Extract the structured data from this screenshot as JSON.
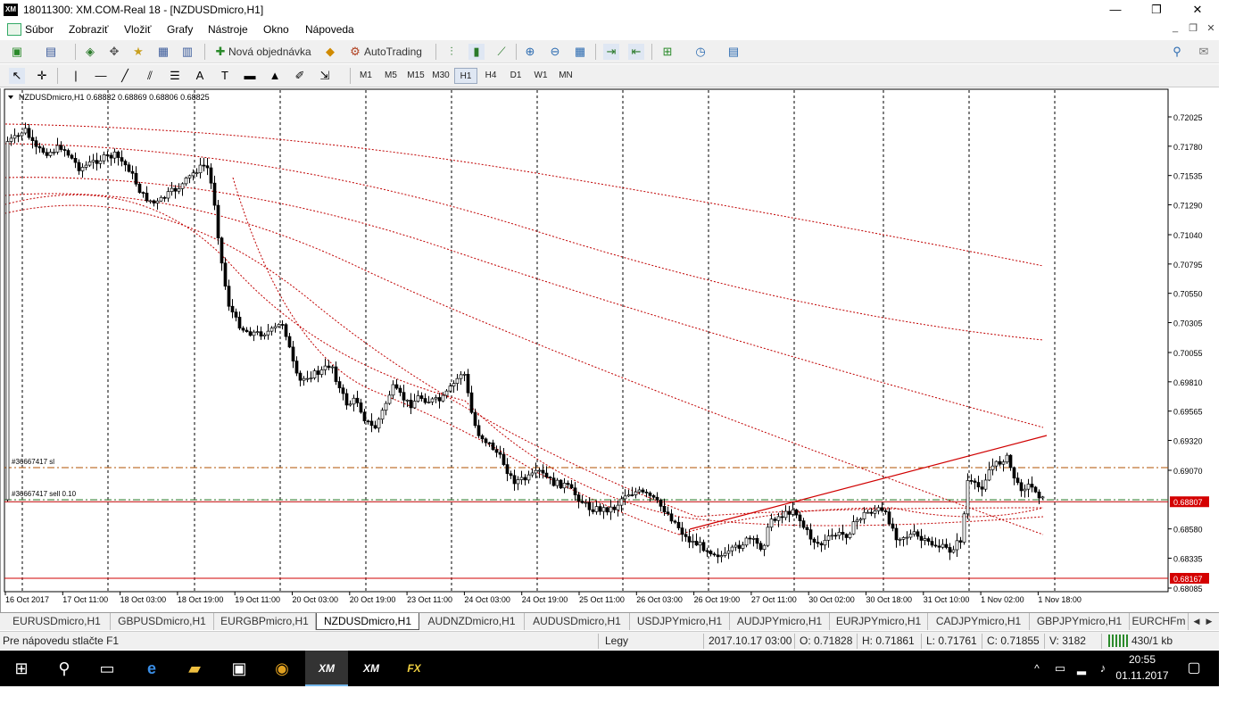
{
  "window": {
    "title": "18011300: XM.COM-Real 18 - [NZDUSDmicro,H1]",
    "logo": "XM",
    "minimize": "—",
    "maximize": "❐",
    "close": "✕"
  },
  "menu": {
    "items": [
      "Súbor",
      "Zobraziť",
      "Vložiť",
      "Grafy",
      "Nástroje",
      "Okno",
      "Nápoveda"
    ],
    "mdi_minimize": "_",
    "mdi_restore": "❐",
    "mdi_close": "✕"
  },
  "toolbar": {
    "new_order_label": "Nová objednávka",
    "autotrading_label": "AutoTrading",
    "timeframes": [
      "M1",
      "M5",
      "M15",
      "M30",
      "H1",
      "H4",
      "D1",
      "W1",
      "MN"
    ],
    "active_timeframe": "H1"
  },
  "chart": {
    "header": "NZDUSDmicro,H1  0.68832 0.68869 0.68806 0.68825",
    "order_labels": {
      "sl": "#36667417 sl",
      "sell": "#36667417 sell 0.10"
    },
    "price_labels": [
      "0.72025",
      "0.71780",
      "0.71535",
      "0.71290",
      "0.71040",
      "0.70795",
      "0.70550",
      "0.70305",
      "0.70055",
      "0.69810",
      "0.69565",
      "0.69320",
      "0.69070",
      "0.68580",
      "0.68335",
      "0.68085"
    ],
    "current_price": "0.68807",
    "red_line_price": "0.68167",
    "time_labels": [
      "16 Oct 2017",
      "17 Oct 11:00",
      "18 Oct 03:00",
      "18 Oct 19:00",
      "19 Oct 11:00",
      "20 Oct 03:00",
      "20 Oct 19:00",
      "23 Oct 11:00",
      "24 Oct 03:00",
      "24 Oct 19:00",
      "25 Oct 11:00",
      "26 Oct 03:00",
      "26 Oct 19:00",
      "27 Oct 11:00",
      "30 Oct 02:00",
      "30 Oct 18:00",
      "31 Oct 10:00",
      "1 Nov 02:00",
      "1 Nov 18:00"
    ],
    "colors": {
      "bull": "#ffffff",
      "bear": "#000000",
      "ma": "#c00000",
      "trendline": "#d00000",
      "current_price_bg": "#d40000"
    }
  },
  "tabs": {
    "items": [
      "EURUSDmicro,H1",
      "GBPUSDmicro,H1",
      "EURGBPmicro,H1",
      "NZDUSDmicro,H1",
      "AUDNZDmicro,H1",
      "AUDUSDmicro,H1",
      "USDJPYmicro,H1",
      "AUDJPYmicro,H1",
      "EURJPYmicro,H1",
      "CADJPYmicro,H1",
      "GBPJPYmicro,H1",
      "EURCHFm"
    ],
    "active": "NZDUSDmicro,H1"
  },
  "status": {
    "help": "Pre nápovedu stlačte F1",
    "profile": "Legy",
    "datetime": "2017.10.17 03:00",
    "open": "O: 0.71828",
    "high": "H: 0.71861",
    "low": "L: 0.71761",
    "close": "C: 0.71855",
    "volume": "V: 3182",
    "connection": "430/1 kb"
  },
  "taskbar": {
    "time": "20:55",
    "date": "01.11.2017"
  }
}
